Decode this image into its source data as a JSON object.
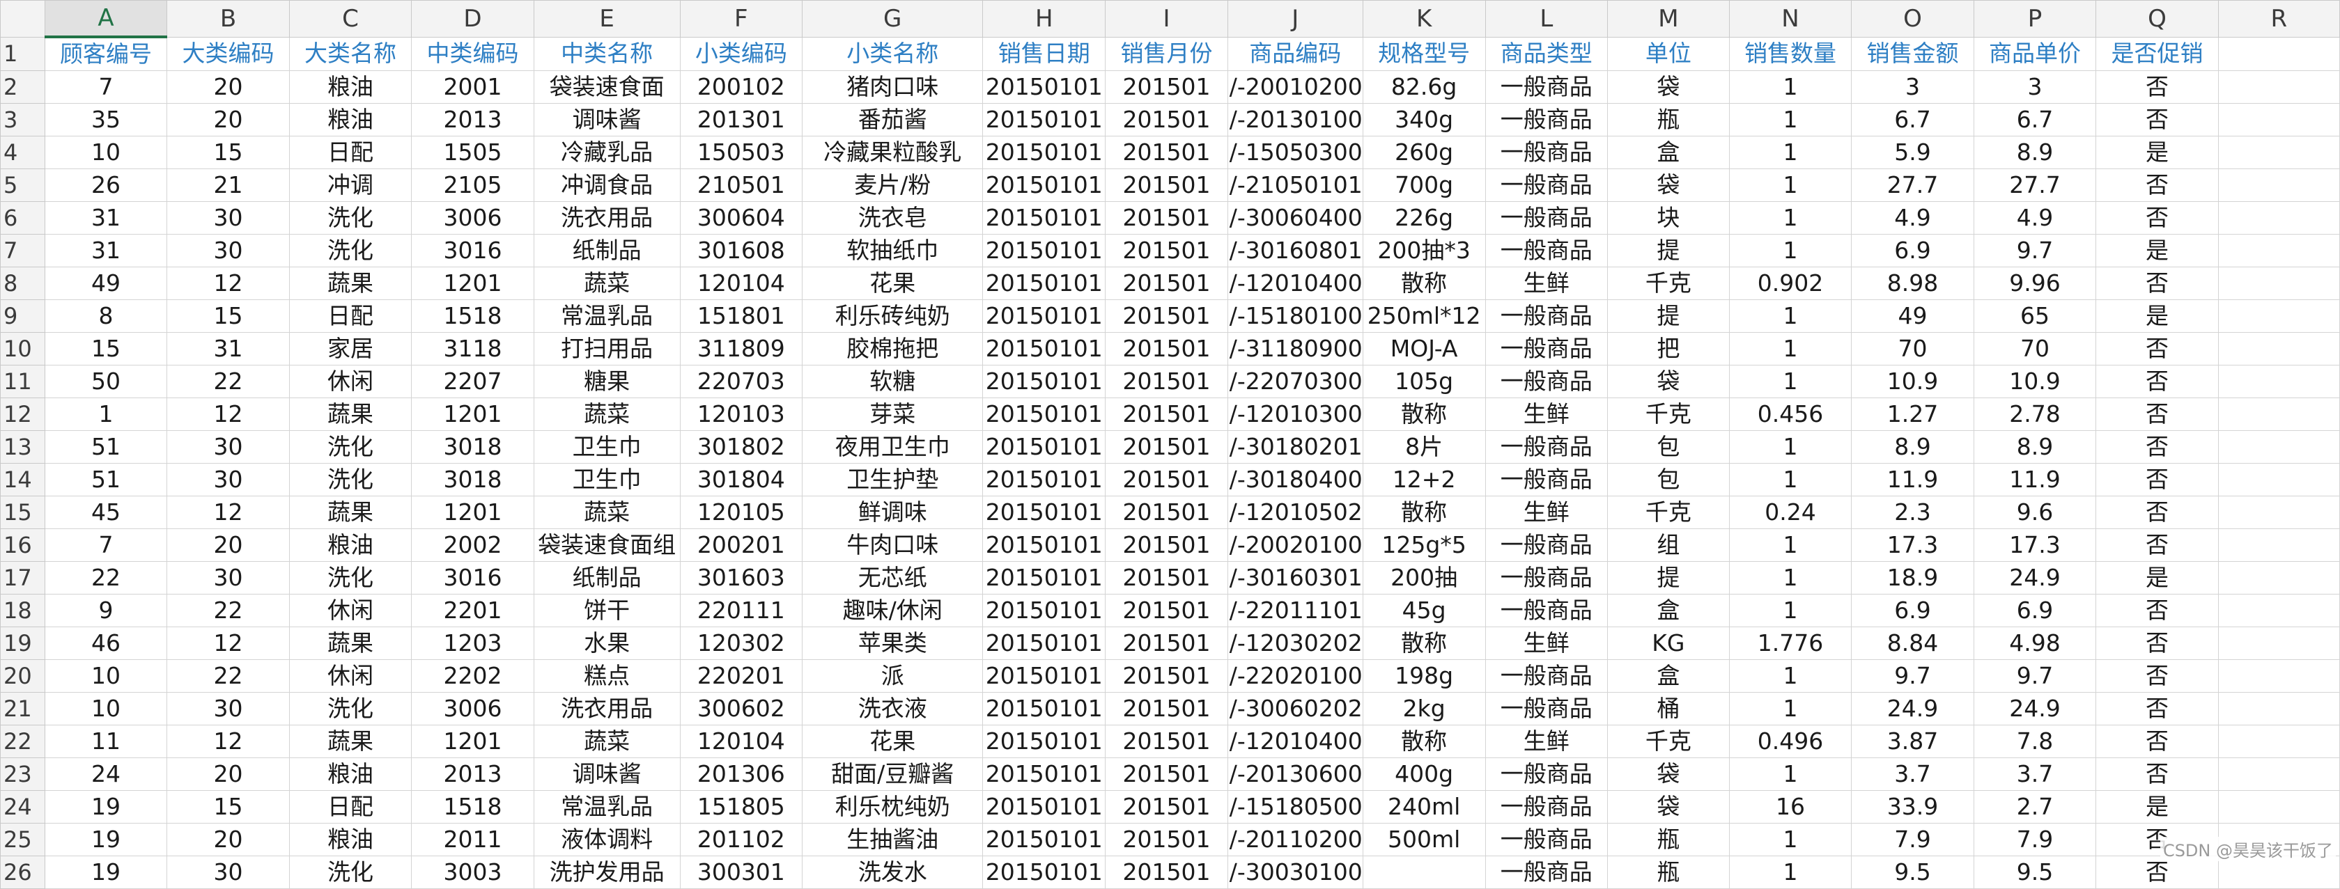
{
  "columns": [
    "A",
    "B",
    "C",
    "D",
    "E",
    "F",
    "G",
    "H",
    "I",
    "J",
    "K",
    "L",
    "M",
    "N",
    "O",
    "P",
    "Q",
    "R"
  ],
  "selected_column": "A",
  "row_numbers": [
    "1",
    "2",
    "3",
    "4",
    "5",
    "6",
    "7",
    "8",
    "9",
    "10",
    "11",
    "12",
    "13",
    "14",
    "15",
    "16",
    "17",
    "18",
    "19",
    "20",
    "21",
    "22",
    "23",
    "24",
    "25",
    "26"
  ],
  "headers": [
    "顾客编号",
    "大类编码",
    "大类名称",
    "中类编码",
    "中类名称",
    "小类编码",
    "小类名称",
    "销售日期",
    "销售月份",
    "商品编码",
    "规格型号",
    "商品类型",
    "单位",
    "销售数量",
    "销售金额",
    "商品单价",
    "是否促销",
    ""
  ],
  "rows": [
    [
      "7",
      "20",
      "粮油",
      "2001",
      "袋装速食面",
      "200102",
      "猪肉口味",
      "20150101",
      "201501",
      "/-20010200",
      "82.6g",
      "一般商品",
      "袋",
      "1",
      "3",
      "3",
      "否",
      ""
    ],
    [
      "35",
      "20",
      "粮油",
      "2013",
      "调味酱",
      "201301",
      "番茄酱",
      "20150101",
      "201501",
      "/-20130100",
      "340g",
      "一般商品",
      "瓶",
      "1",
      "6.7",
      "6.7",
      "否",
      ""
    ],
    [
      "10",
      "15",
      "日配",
      "1505",
      "冷藏乳品",
      "150503",
      "冷藏果粒酸乳",
      "20150101",
      "201501",
      "/-15050300",
      "260g",
      "一般商品",
      "盒",
      "1",
      "5.9",
      "8.9",
      "是",
      ""
    ],
    [
      "26",
      "21",
      "冲调",
      "2105",
      "冲调食品",
      "210501",
      "麦片/粉",
      "20150101",
      "201501",
      "/-21050101",
      "700g",
      "一般商品",
      "袋",
      "1",
      "27.7",
      "27.7",
      "否",
      ""
    ],
    [
      "31",
      "30",
      "洗化",
      "3006",
      "洗衣用品",
      "300604",
      "洗衣皂",
      "20150101",
      "201501",
      "/-30060400",
      "226g",
      "一般商品",
      "块",
      "1",
      "4.9",
      "4.9",
      "否",
      ""
    ],
    [
      "31",
      "30",
      "洗化",
      "3016",
      "纸制品",
      "301608",
      "软抽纸巾",
      "20150101",
      "201501",
      "/-30160801",
      "200抽*3",
      "一般商品",
      "提",
      "1",
      "6.9",
      "9.7",
      "是",
      ""
    ],
    [
      "49",
      "12",
      "蔬果",
      "1201",
      "蔬菜",
      "120104",
      "花果",
      "20150101",
      "201501",
      "/-12010400",
      "散称",
      "生鲜",
      "千克",
      "0.902",
      "8.98",
      "9.96",
      "否",
      ""
    ],
    [
      "8",
      "15",
      "日配",
      "1518",
      "常温乳品",
      "151801",
      "利乐砖纯奶",
      "20150101",
      "201501",
      "/-15180100",
      "250ml*12",
      "一般商品",
      "提",
      "1",
      "49",
      "65",
      "是",
      ""
    ],
    [
      "15",
      "31",
      "家居",
      "3118",
      "打扫用品",
      "311809",
      "胶棉拖把",
      "20150101",
      "201501",
      "/-31180900",
      "MOJ-A",
      "一般商品",
      "把",
      "1",
      "70",
      "70",
      "否",
      ""
    ],
    [
      "50",
      "22",
      "休闲",
      "2207",
      "糖果",
      "220703",
      "软糖",
      "20150101",
      "201501",
      "/-22070300",
      "105g",
      "一般商品",
      "袋",
      "1",
      "10.9",
      "10.9",
      "否",
      ""
    ],
    [
      "1",
      "12",
      "蔬果",
      "1201",
      "蔬菜",
      "120103",
      "芽菜",
      "20150101",
      "201501",
      "/-12010300",
      "散称",
      "生鲜",
      "千克",
      "0.456",
      "1.27",
      "2.78",
      "否",
      ""
    ],
    [
      "51",
      "30",
      "洗化",
      "3018",
      "卫生巾",
      "301802",
      "夜用卫生巾",
      "20150101",
      "201501",
      "/-30180201",
      "8片",
      "一般商品",
      "包",
      "1",
      "8.9",
      "8.9",
      "否",
      ""
    ],
    [
      "51",
      "30",
      "洗化",
      "3018",
      "卫生巾",
      "301804",
      "卫生护垫",
      "20150101",
      "201501",
      "/-30180400",
      "12+2",
      "一般商品",
      "包",
      "1",
      "11.9",
      "11.9",
      "否",
      ""
    ],
    [
      "45",
      "12",
      "蔬果",
      "1201",
      "蔬菜",
      "120105",
      "鲜调味",
      "20150101",
      "201501",
      "/-12010502",
      "散称",
      "生鲜",
      "千克",
      "0.24",
      "2.3",
      "9.6",
      "否",
      ""
    ],
    [
      "7",
      "20",
      "粮油",
      "2002",
      "袋装速食面组",
      "200201",
      "牛肉口味",
      "20150101",
      "201501",
      "/-20020100",
      "125g*5",
      "一般商品",
      "组",
      "1",
      "17.3",
      "17.3",
      "否",
      ""
    ],
    [
      "22",
      "30",
      "洗化",
      "3016",
      "纸制品",
      "301603",
      "无芯纸",
      "20150101",
      "201501",
      "/-30160301",
      "200抽",
      "一般商品",
      "提",
      "1",
      "18.9",
      "24.9",
      "是",
      ""
    ],
    [
      "9",
      "22",
      "休闲",
      "2201",
      "饼干",
      "220111",
      "趣味/休闲",
      "20150101",
      "201501",
      "/-22011101",
      "45g",
      "一般商品",
      "盒",
      "1",
      "6.9",
      "6.9",
      "否",
      ""
    ],
    [
      "46",
      "12",
      "蔬果",
      "1203",
      "水果",
      "120302",
      "苹果类",
      "20150101",
      "201501",
      "/-12030202",
      "散称",
      "生鲜",
      "KG",
      "1.776",
      "8.84",
      "4.98",
      "否",
      ""
    ],
    [
      "10",
      "22",
      "休闲",
      "2202",
      "糕点",
      "220201",
      "派",
      "20150101",
      "201501",
      "/-22020100",
      "198g",
      "一般商品",
      "盒",
      "1",
      "9.7",
      "9.7",
      "否",
      ""
    ],
    [
      "10",
      "30",
      "洗化",
      "3006",
      "洗衣用品",
      "300602",
      "洗衣液",
      "20150101",
      "201501",
      "/-30060202",
      "2kg",
      "一般商品",
      "桶",
      "1",
      "24.9",
      "24.9",
      "否",
      ""
    ],
    [
      "11",
      "12",
      "蔬果",
      "1201",
      "蔬菜",
      "120104",
      "花果",
      "20150101",
      "201501",
      "/-12010400",
      "散称",
      "生鲜",
      "千克",
      "0.496",
      "3.87",
      "7.8",
      "否",
      ""
    ],
    [
      "24",
      "20",
      "粮油",
      "2013",
      "调味酱",
      "201306",
      "甜面/豆瓣酱",
      "20150101",
      "201501",
      "/-20130600",
      "400g",
      "一般商品",
      "袋",
      "1",
      "3.7",
      "3.7",
      "否",
      ""
    ],
    [
      "19",
      "15",
      "日配",
      "1518",
      "常温乳品",
      "151805",
      "利乐枕纯奶",
      "20150101",
      "201501",
      "/-15180500",
      "240ml",
      "一般商品",
      "袋",
      "16",
      "33.9",
      "2.7",
      "是",
      ""
    ],
    [
      "19",
      "20",
      "粮油",
      "2011",
      "液体调料",
      "201102",
      "生抽酱油",
      "20150101",
      "201501",
      "/-20110200",
      "500ml",
      "一般商品",
      "瓶",
      "1",
      "7.9",
      "7.9",
      "否",
      ""
    ],
    [
      "19",
      "30",
      "洗化",
      "3003",
      "洗护发用品",
      "300301",
      "洗发水",
      "20150101",
      "201501",
      "/-30030100",
      "",
      "一般商品",
      "瓶",
      "1",
      "9.5",
      "9.5",
      "否",
      ""
    ]
  ],
  "watermark": "CSDN @昊昊该干饭了"
}
